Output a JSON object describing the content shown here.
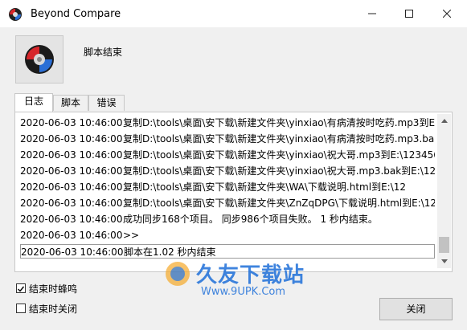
{
  "window": {
    "title": "Beyond Compare"
  },
  "header": {
    "text": "脚本结束"
  },
  "tabs": [
    {
      "label": "日志"
    },
    {
      "label": "脚本"
    },
    {
      "label": "错误"
    }
  ],
  "log": {
    "rows": [
      {
        "date": "2020-06-03 10:46:00",
        "message": "复制D:\\tools\\桌面\\安下载\\新建文件夹\\yinxiao\\有病清按时吃药.mp3到E:\\"
      },
      {
        "date": "2020-06-03 10:46:00",
        "message": "复制D:\\tools\\桌面\\安下载\\新建文件夹\\yinxiao\\有病清按时吃药.mp3.bak"
      },
      {
        "date": "2020-06-03 10:46:00",
        "message": "复制D:\\tools\\桌面\\安下载\\新建文件夹\\yinxiao\\祝大哥.mp3到E:\\123456"
      },
      {
        "date": "2020-06-03 10:46:00",
        "message": "复制D:\\tools\\桌面\\安下载\\新建文件夹\\yinxiao\\祝大哥.mp3.bak到E:\\123"
      },
      {
        "date": "2020-06-03 10:46:00",
        "message": "复制D:\\tools\\桌面\\安下载\\新建文件夹\\WA\\下载说明.html到E:\\12"
      },
      {
        "date": "2020-06-03 10:46:00",
        "message": "复制D:\\tools\\桌面\\安下载\\新建文件夹\\ZnZqDPG\\下载说明.html到E:\\12"
      },
      {
        "date": "2020-06-03 10:46:00",
        "message": "成功同步168个项目。    同步986个项目失败。    1 秒内结束。"
      },
      {
        "date": "2020-06-03 10:46:00",
        "message": ">>"
      },
      {
        "date": "2020-06-03 10:46:00",
        "message": "脚本在1.02 秒内结束"
      }
    ]
  },
  "watermark": {
    "brand": "久友下载站",
    "url": "Www.9UPK.Com"
  },
  "options": {
    "beep_label": "结束时蜂鸣",
    "beep_checked": true,
    "close_label": "结束时关闭",
    "close_checked": false
  },
  "buttons": {
    "close_label": "关闭"
  },
  "colors": {
    "watermark": "#1e6fd9",
    "icon_red": "#d7262b",
    "icon_blue": "#2b6fd6"
  }
}
